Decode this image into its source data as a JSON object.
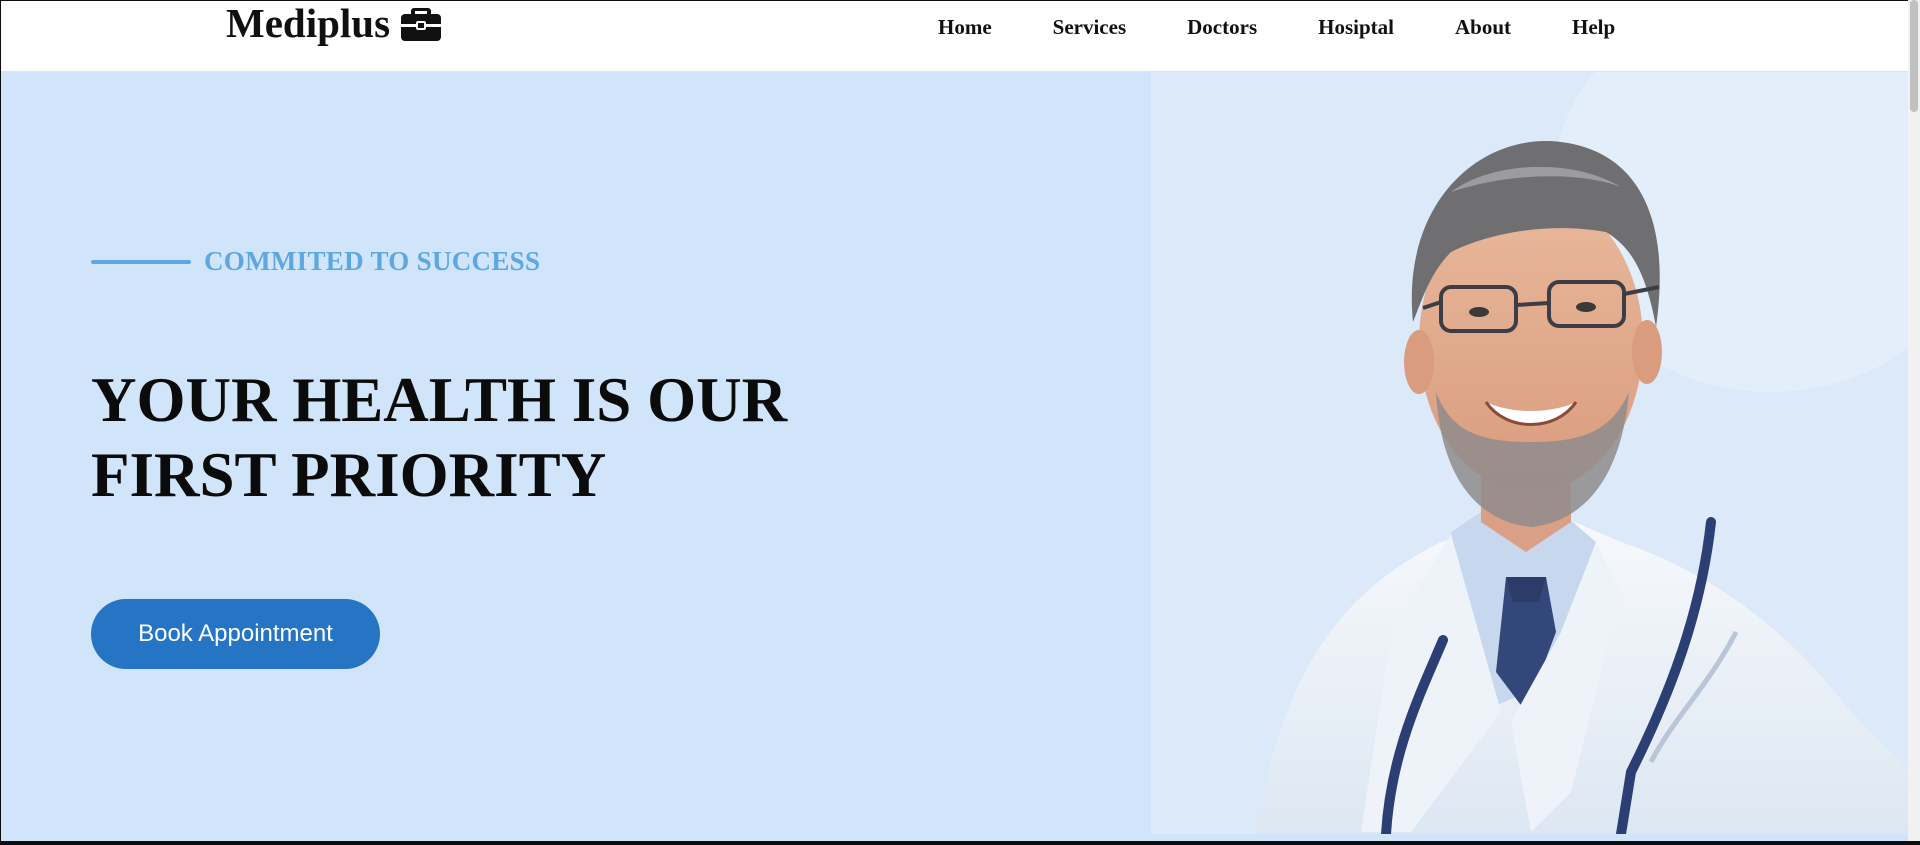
{
  "header": {
    "logo_text": "Mediplus",
    "logo_icon": "briefcase-medical-icon",
    "nav": [
      {
        "label": "Home"
      },
      {
        "label": "Services"
      },
      {
        "label": "Doctors"
      },
      {
        "label": "Hosiptal"
      },
      {
        "label": "About"
      },
      {
        "label": "Help"
      }
    ]
  },
  "hero": {
    "tagline": "COMMITED TO SUCCESS",
    "headline_line1": "YOUR HEALTH IS OUR",
    "headline_line2": "FIRST PRIORITY",
    "cta_label": "Book Appointment",
    "photo": "doctor-portrait-image"
  },
  "colors": {
    "hero_background": "#d0e5f9",
    "accent": "#5ea7e3",
    "button": "#2575c4",
    "header_background": "#ffffff"
  }
}
